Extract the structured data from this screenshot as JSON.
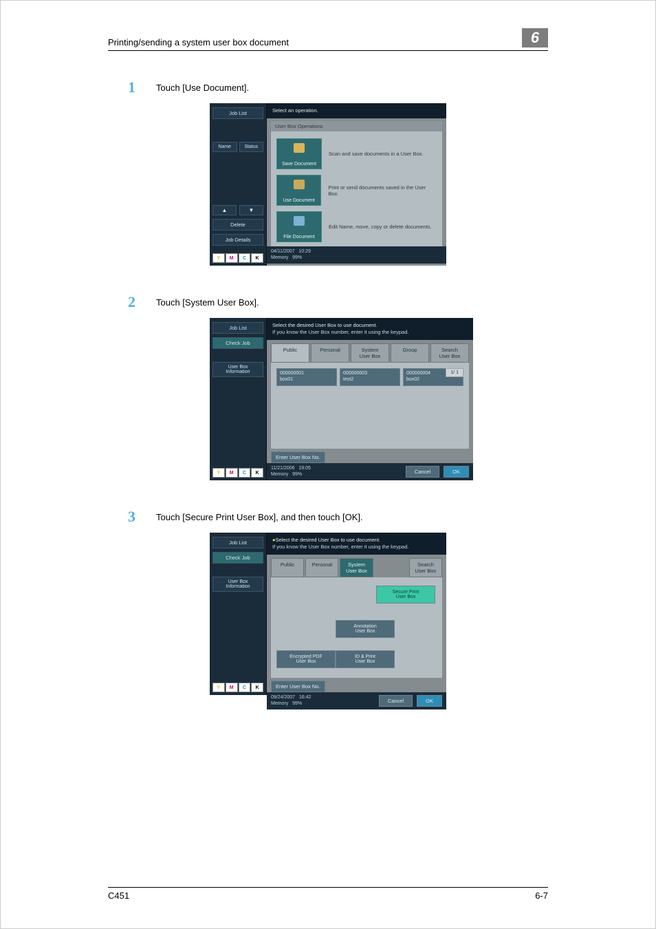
{
  "page": {
    "header_title": "Printing/sending a system user box document",
    "chapter": "6",
    "footer_model": "C451",
    "footer_page": "6-7"
  },
  "steps": {
    "s1": {
      "num": "1",
      "text": "Touch [Use Document]."
    },
    "s2": {
      "num": "2",
      "text": "Touch [System User Box]."
    },
    "s3": {
      "num": "3",
      "text": "Touch [Secure Print User Box], and then touch [OK]."
    }
  },
  "labels": {
    "job_list": "Job List",
    "check_job": "Check Job",
    "status": "Status",
    "name": "Name",
    "delete": "Delete",
    "job_details": "Job Details",
    "user_box_info": "User Box\nInformation",
    "cancel": "Cancel",
    "ok": "OK",
    "enter_box_no": "Enter User Box No.",
    "page_ind": "1/  1"
  },
  "tabs": {
    "public": "Public",
    "personal": "Personal",
    "system": "System\nUser Box",
    "group": "Group",
    "search": "Search\nUser Box"
  },
  "shot1": {
    "top": "Select an operation.",
    "section": "User Box Operations",
    "save": "Save Document",
    "save_desc": "Scan and save documents in a User Box.",
    "use": "Use Document",
    "use_desc": "Print or send documents saved in the User Box.",
    "file": "File Document",
    "file_desc": "Edit Name, move, copy or delete documents.",
    "date": "04/11/2007",
    "time": "10:29",
    "mem": "Memory",
    "mem_v": "99%"
  },
  "shot2": {
    "top1": "Select the desired User Box to use document.",
    "top2": "If you know the User Box number, enter it using the keypad.",
    "boxes": [
      {
        "no": "000000001",
        "name": "box01"
      },
      {
        "no": "000000003",
        "name": "test2"
      },
      {
        "no": "000000004",
        "name": "box02"
      }
    ],
    "date": "11/21/2006",
    "time": "19:05",
    "mem": "Memory",
    "mem_v": "99%"
  },
  "shot3": {
    "top1": "Select the desired User Box to use document.",
    "top2": "If you know the User Box number, enter it using the keypad.",
    "secure": "Secure Print\nUser Box",
    "annot": "Annotation\nUser Box",
    "encpdf": "Encrypted PDF\nUser Box",
    "idprint": "ID & Print\nUser Box",
    "date": "09/24/2007",
    "time": "16:42",
    "mem": "Memory",
    "mem_v": "99%"
  },
  "toner": {
    "y": "Y",
    "m": "M",
    "c": "C",
    "k": "K"
  }
}
